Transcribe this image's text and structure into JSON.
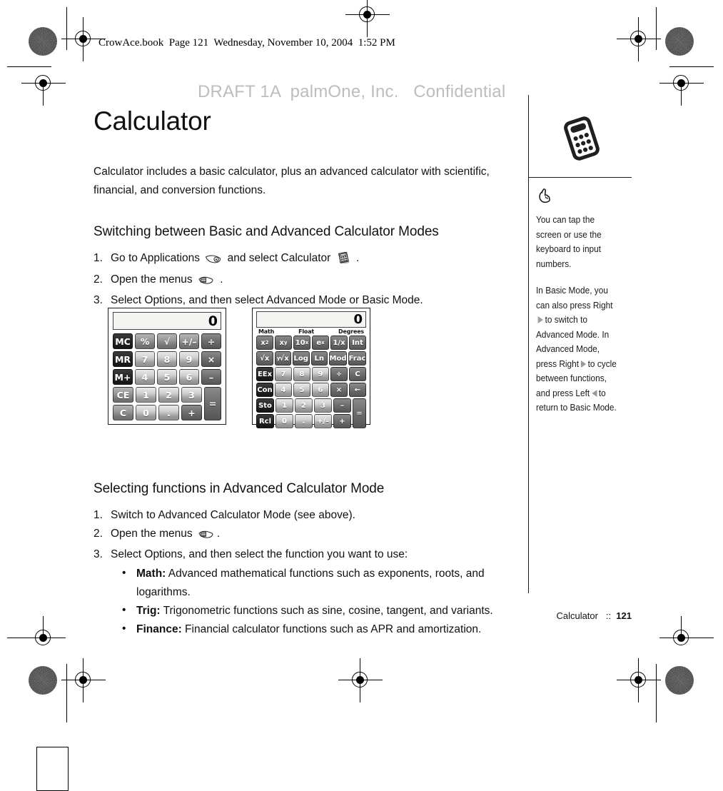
{
  "print_header": {
    "book_line": "CrowAce.book  Page 121  Wednesday, November 10, 2004  1:52 PM",
    "draft_notice": "DRAFT 1A  palmOne, Inc.   Confidential"
  },
  "main": {
    "title": "Calculator",
    "intro": "Calculator includes a basic calculator, plus an advanced calculator with scientific, financial, and conversion functions.",
    "section1": {
      "heading": "Switching between Basic and Advanced Calculator Modes",
      "steps": [
        {
          "num": "1.",
          "pre": "Go to Applications",
          "mid": "and select Calculator",
          "post": "."
        },
        {
          "num": "2.",
          "pre": "Open the menus",
          "mid": "",
          "post": "."
        },
        {
          "num": "3.",
          "pre": "Select Options, and then select Advanced Mode or Basic Mode.",
          "mid": "",
          "post": ""
        }
      ]
    },
    "section2": {
      "heading": "Selecting functions in Advanced Calculator Mode",
      "steps": [
        {
          "num": "1.",
          "text": "Switch to Advanced Calculator Mode (see above)."
        },
        {
          "num": "2.",
          "text": "Open the menus"
        },
        {
          "num": "3.",
          "text": "Select Options, and then select the function you want to use:"
        }
      ],
      "bullets": [
        {
          "bullet": "•",
          "term": "Math:",
          "text": " Advanced mathematical functions such as exponents, roots, and logarithms."
        },
        {
          "bullet": "•",
          "term": "Trig:",
          "text": " Trigonometric functions such as sine, cosine, tangent, and variants."
        },
        {
          "bullet": "•",
          "term": "Finance:",
          "text": " Financial calculator functions such as APR and amortization."
        }
      ]
    }
  },
  "figures": {
    "basic_calculator": {
      "display": "0",
      "rows": [
        [
          {
            "label": "MC",
            "style": "dark"
          },
          {
            "label": "%",
            "style": "grey"
          },
          {
            "label": "√",
            "style": "grey"
          },
          {
            "label": "+/–",
            "style": "grey"
          },
          {
            "label": "÷",
            "style": "darkmid"
          }
        ],
        [
          {
            "label": "MR",
            "style": "dark"
          },
          {
            "label": "7",
            "style": "silver"
          },
          {
            "label": "8",
            "style": "silver"
          },
          {
            "label": "9",
            "style": "silver"
          },
          {
            "label": "×",
            "style": "darkmid"
          }
        ],
        [
          {
            "label": "M+",
            "style": "dark"
          },
          {
            "label": "4",
            "style": "silver"
          },
          {
            "label": "5",
            "style": "silver"
          },
          {
            "label": "6",
            "style": "silver"
          },
          {
            "label": "–",
            "style": "darkmid"
          }
        ],
        [
          {
            "label": "CE",
            "style": "grey"
          },
          {
            "label": "1",
            "style": "silver"
          },
          {
            "label": "2",
            "style": "silver"
          },
          {
            "label": "3",
            "style": "silver"
          },
          {
            "label": "=",
            "style": "darkmid",
            "tall": true
          }
        ],
        [
          {
            "label": "C",
            "style": "grey"
          },
          {
            "label": "0",
            "style": "silver"
          },
          {
            "label": ".",
            "style": "silver"
          },
          {
            "label": "+",
            "style": "darkmid"
          }
        ]
      ]
    },
    "advanced_calculator": {
      "display": "0",
      "mode_labels": [
        "Math",
        "Float",
        "Degrees"
      ],
      "rows": [
        [
          {
            "label": "x²",
            "style": "darkmid"
          },
          {
            "label": "xʸ",
            "style": "darkmid"
          },
          {
            "label": "10ˣ",
            "style": "darkmid"
          },
          {
            "label": "eˣ",
            "style": "darkmid"
          },
          {
            "label": "1/x",
            "style": "darkmid"
          },
          {
            "label": "Int",
            "style": "darkmid"
          }
        ],
        [
          {
            "label": "√x",
            "style": "darkmid"
          },
          {
            "label": "ʸ√x",
            "style": "darkmid"
          },
          {
            "label": "Log",
            "style": "darkmid"
          },
          {
            "label": "Ln",
            "style": "darkmid"
          },
          {
            "label": "Mod",
            "style": "darkmid"
          },
          {
            "label": "Frac",
            "style": "darkmid"
          }
        ],
        [
          {
            "label": "EEx",
            "style": "dark"
          },
          {
            "label": "7",
            "style": "silver"
          },
          {
            "label": "8",
            "style": "silver"
          },
          {
            "label": "9",
            "style": "silver"
          },
          {
            "label": "÷",
            "style": "darkmid"
          },
          {
            "label": "C",
            "style": "darkmid"
          }
        ],
        [
          {
            "label": "Con",
            "style": "dark"
          },
          {
            "label": "4",
            "style": "silver"
          },
          {
            "label": "5",
            "style": "silver"
          },
          {
            "label": "6",
            "style": "silver"
          },
          {
            "label": "×",
            "style": "darkmid"
          },
          {
            "label": "←",
            "style": "darkmid"
          }
        ],
        [
          {
            "label": "Sto",
            "style": "dark"
          },
          {
            "label": "1",
            "style": "silver"
          },
          {
            "label": "2",
            "style": "silver"
          },
          {
            "label": "3",
            "style": "silver"
          },
          {
            "label": "–",
            "style": "darkmid"
          },
          {
            "label": "=",
            "style": "darkmid",
            "tall": true
          }
        ],
        [
          {
            "label": "Rcl",
            "style": "dark"
          },
          {
            "label": "0",
            "style": "silver"
          },
          {
            "label": ".",
            "style": "silver"
          },
          {
            "label": "+/–",
            "style": "silver"
          },
          {
            "label": "+",
            "style": "darkmid"
          }
        ]
      ]
    }
  },
  "sidebar": {
    "icon": "calculator-icon",
    "tip_icon": "pointing-hand-icon",
    "paragraphs": [
      "You can tap the screen or use the keyboard to input numbers.",
      "In Basic Mode, you can also press Right ▶ to switch to Advanced Mode. In Advanced Mode, press Right ▶ to cycle between functions, and press Left ◀ to return to Basic Mode."
    ],
    "p2_parts": {
      "a": "In Basic Mode, you can also press Right",
      "b": "to switch to Advanced Mode. In Advanced Mode, press Right",
      "c": "to cycle between functions, and press Left",
      "d": "to return to Basic Mode."
    }
  },
  "footer": {
    "chapter": "Calculator",
    "separator": "::",
    "page_number": "121"
  }
}
